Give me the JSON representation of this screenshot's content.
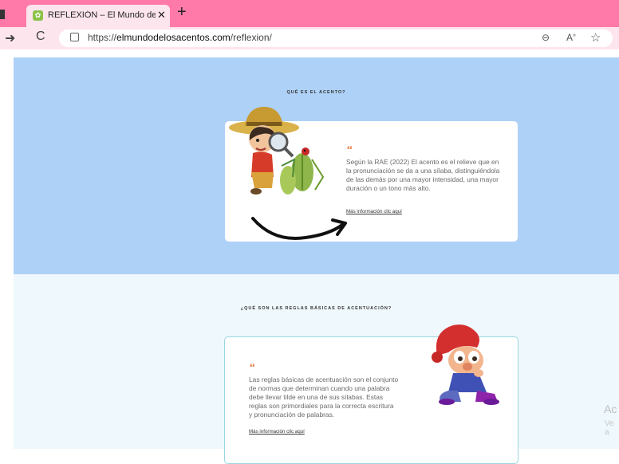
{
  "browser": {
    "tab_title": "REFLEXIÓN – El Mundo de los Ac",
    "tab_close": "✕",
    "new_tab": "+",
    "url_prefix": "https://",
    "url_domain": "elmundodelosacentos.com",
    "url_path": "/reflexion/",
    "nav_forward": "➜",
    "nav_reload": "C"
  },
  "section1": {
    "heading": "QUÉ ES EL ACENTO?",
    "quote": "“",
    "text": "Según la RAE (2022) El acento es el relieve que en la pronunciación se da a una sílaba, distinguiéndola de las demás por una mayor intensidad, una mayor duración o un tono más alto.",
    "link": "Más información clic aquí",
    "illustration": "boy-explorer-with-magnifying-glass",
    "arrow": "curved-arrow-right"
  },
  "section2": {
    "heading": "¿QUÉ SON LAS REGLAS BÁSICAS DE ACENTUACIÓN?",
    "quote": "“",
    "text": "Las reglas básicas de acentuación son el conjunto de normas que determinan cuando una palabra debe llevar tilde en una de sus sílabas. Estas reglas son primordiales para la correcta escritura y pronunciación de palabras.",
    "link": "Más información clic aquí",
    "illustration": "thinking-gnome-with-red-hat"
  },
  "watermark": {
    "line1": "Ac",
    "line2": "Ve a"
  },
  "colors": {
    "tabbar": "#ff7aa8",
    "section1_bg": "#aed1f7",
    "section2_bg": "#eff8fc",
    "quote_accent": "#e87a3c"
  }
}
